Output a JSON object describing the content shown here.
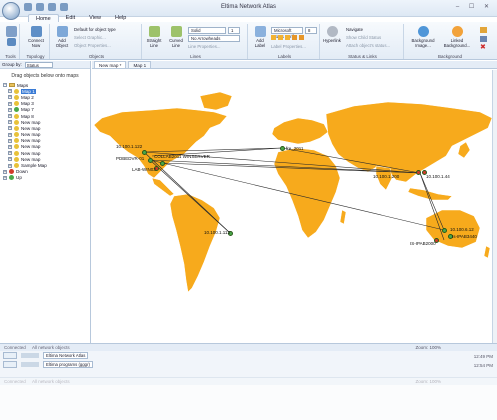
{
  "app": {
    "title": "Eltima Network Atlas",
    "window_controls": "‒ ☐ ✕"
  },
  "ribbon_tabs": [
    "Home",
    "Edit",
    "View",
    "Help"
  ],
  "ribbon": {
    "tools": {
      "label": "Tools"
    },
    "topology": {
      "label": "Topology",
      "connect": "Connect",
      "now": "Now"
    },
    "objects": {
      "label": "Objects",
      "add": "Add",
      "object": "Object",
      "default_type": "Default for object type",
      "select_graphic": "Select Graphic...",
      "properties": "Object Properties..."
    },
    "lines": {
      "label": "Lines",
      "straight": "Straight",
      "curved": "Curved",
      "line": "Line",
      "line2": "Line",
      "style_value": "Solid",
      "width_value": "1",
      "arrow_value": "No Arrowheads",
      "properties": "Line Properties..."
    },
    "labels": {
      "label": "Labels",
      "add": "Add",
      "label_btn": "Label",
      "font_value": "Microsoft Sans Serif",
      "size_value": "8",
      "properties": "Label Properties..."
    },
    "status": {
      "label": "Status & Links",
      "hyperlink": "Hyperlink",
      "navigate": "Navigate",
      "show_child": "Show Child Status",
      "attach": "Attach object's status..."
    },
    "background": {
      "label": "Background",
      "image": "Background",
      "image2": "Image...",
      "linked": "Linked",
      "linked2": "Background..."
    }
  },
  "left_panel": {
    "group_by_label": "Group by:",
    "group_by_value": "Status",
    "drag_hint": "Drag objects below onto maps",
    "tree": [
      {
        "label": "Maps",
        "level": 0,
        "kind": "folder"
      },
      {
        "label": "Map 1",
        "level": 1,
        "color": "#e8c23a",
        "selected": true
      },
      {
        "label": "Map 2",
        "level": 1,
        "color": "#e8c23a"
      },
      {
        "label": "Map 3",
        "level": 1,
        "color": "#e8c23a"
      },
      {
        "label": "Map 7",
        "level": 1,
        "color": "#4aa84a"
      },
      {
        "label": "Map 8",
        "level": 1,
        "color": "#e8c23a"
      },
      {
        "label": "New map",
        "level": 1,
        "color": "#e8c23a"
      },
      {
        "label": "New map",
        "level": 1,
        "color": "#e8c23a"
      },
      {
        "label": "New map",
        "level": 1,
        "color": "#e8c23a"
      },
      {
        "label": "New map",
        "level": 1,
        "color": "#e8c23a"
      },
      {
        "label": "New map",
        "level": 1,
        "color": "#e8c23a"
      },
      {
        "label": "New map",
        "level": 1,
        "color": "#e8c23a"
      },
      {
        "label": "New map",
        "level": 1,
        "color": "#e8c23a"
      },
      {
        "label": "Sample Map",
        "level": 1,
        "color": "#e8c23a"
      },
      {
        "label": "Down",
        "level": 0,
        "color": "#d23a2a"
      },
      {
        "label": "Up",
        "level": 0,
        "color": "#4aa84a"
      }
    ]
  },
  "doc_tabs": [
    "New map *",
    "Map 1"
  ],
  "map": {
    "labels": [
      {
        "text": "10.100.1.122",
        "color": "#4aa84a"
      },
      {
        "text": "PDBEDVR-01",
        "color": "#4aa84a"
      },
      {
        "text": "COLLAB2011 WINSERVER",
        "color": "#4aa84a"
      },
      {
        "text": "LAB-WIN03",
        "color": "#d23a2a"
      },
      {
        "text": "fre_2011",
        "color": "#4aa84a"
      },
      {
        "text": "10.100.1.200",
        "color": "#d23a2a"
      },
      {
        "text": "10.100.1.44",
        "color": "#d23a2a"
      },
      {
        "text": "10.100.1.113",
        "color": "#4aa84a"
      },
      {
        "text": "10.100.6.12",
        "color": "#4aa84a"
      },
      {
        "text": "IS-IPAB2000",
        "color": "#d23a2a"
      },
      {
        "text": "Is-IPAB3440",
        "color": "#4aa84a"
      }
    ]
  },
  "bottom": {
    "panel1_title": "Connected",
    "panel1_col": "All network objects",
    "panel1_item1": "Eltima Network Atlas",
    "panel1_item2": "Eltima programs (gggr)",
    "panel1_zoom": "Zoom: 100%",
    "panel1_time1": "12:49 PM",
    "panel1_time2": "12:54 PM",
    "panel2_title": "Connected",
    "panel2_col": "All network objects",
    "panel2_zoom": "Zoom: 100%"
  }
}
